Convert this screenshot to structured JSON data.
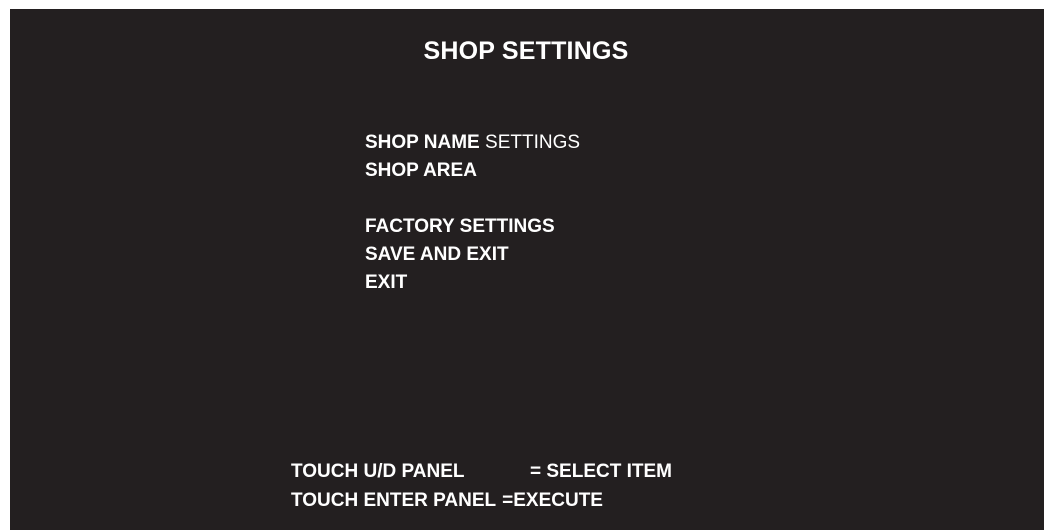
{
  "title": "SHOP SETTINGS",
  "menu": {
    "shop_name_label": "SHOP NAME",
    "shop_name_value": "SETTINGS",
    "shop_area_label": "SHOP AREA",
    "factory_settings_label": "FACTORY SETTINGS",
    "save_and_exit_label": "SAVE AND EXIT",
    "exit_label": "EXIT"
  },
  "help": [
    {
      "action": "TOUCH U/D PANEL",
      "result": "= SELECT ITEM"
    },
    {
      "action": "TOUCH ENTER PANEL",
      "result": "=EXECUTE"
    }
  ],
  "colors": {
    "background": "#231f20",
    "text": "#ffffff"
  }
}
